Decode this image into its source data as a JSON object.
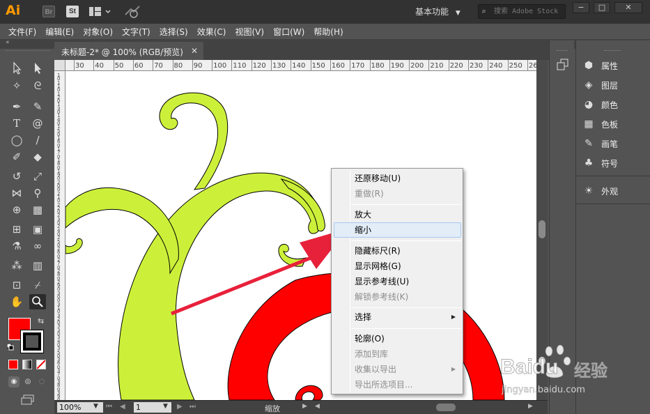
{
  "app": {
    "logo": "Ai",
    "bridge_label": "Br",
    "stock_label": "St",
    "workspace": "基本功能",
    "search_placeholder": "搜索 Adobe Stock"
  },
  "menu": [
    "文件(F)",
    "编辑(E)",
    "对象(O)",
    "文字(T)",
    "选择(S)",
    "效果(C)",
    "视图(V)",
    "窗口(W)",
    "帮助(H)"
  ],
  "document": {
    "tab_title": "未标题-2* @ 100% (RGB/预览)",
    "ruler_h": [
      "30",
      "40",
      "50",
      "60",
      "70",
      "80",
      "90",
      "100",
      "110",
      "120",
      "130",
      "140",
      "150",
      "160",
      "170",
      "180",
      "190",
      "200",
      "210",
      "220",
      "230",
      "240",
      "250",
      "26"
    ],
    "ruler_v": [
      "1",
      "0",
      "1",
      "1",
      "0",
      "1",
      "2",
      "0",
      "1",
      "3",
      "0",
      "1",
      "4",
      "0",
      "1",
      "5",
      "0",
      "1",
      "6",
      "0",
      "1",
      "7",
      "0",
      "1",
      "8",
      "0",
      "1",
      "9",
      "0",
      "2",
      "0",
      "0",
      "2",
      "1",
      "0",
      "2",
      "2",
      "0",
      "2",
      "3",
      "0",
      "2",
      "4",
      "0",
      "2",
      "5",
      "0",
      "2",
      "6",
      "0",
      "2",
      "7",
      "0",
      "2",
      "8",
      "0",
      "2",
      "9",
      "0",
      "3",
      "0",
      "0",
      "3",
      "1",
      "0",
      "3",
      "2",
      "0",
      "3",
      "3",
      "0",
      "3",
      "4",
      "0",
      "3",
      "5",
      "0",
      "3",
      "6",
      "0",
      "3",
      "7",
      "0",
      "3",
      "8",
      "0",
      "3",
      "9",
      "0",
      "4",
      "0",
      "0"
    ]
  },
  "status": {
    "zoom": "100%",
    "page": "1",
    "tool_name": "缩放"
  },
  "colors": {
    "fill": "#ff0000",
    "stroke": "#000000",
    "vine": "#ccf03a",
    "spiral": "#ff0000",
    "arrow": "#e8213a"
  },
  "panels": [
    {
      "icon": "properties-icon",
      "label": "属性"
    },
    {
      "icon": "layers-icon",
      "label": "图层"
    },
    {
      "icon": "color-icon",
      "label": "颜色"
    },
    {
      "icon": "swatches-icon",
      "label": "色板"
    },
    {
      "icon": "brushes-icon",
      "label": "画笔"
    },
    {
      "icon": "symbols-icon",
      "label": "符号"
    },
    {
      "icon": "appearance-icon",
      "label": "外观"
    }
  ],
  "context_menu": {
    "items": [
      {
        "label": "还原移动(U)",
        "enabled": true
      },
      {
        "label": "重做(R)",
        "enabled": false
      },
      {
        "label": "放大",
        "enabled": true
      },
      {
        "label": "缩小",
        "enabled": true,
        "highlighted": true
      },
      {
        "label": "隐藏标尺(R)",
        "enabled": true
      },
      {
        "label": "显示网格(G)",
        "enabled": true
      },
      {
        "label": "显示参考线(U)",
        "enabled": true
      },
      {
        "label": "解锁参考线(K)",
        "enabled": false
      },
      {
        "label": "选择",
        "enabled": true,
        "submenu": true
      },
      {
        "label": "轮廓(O)",
        "enabled": true
      },
      {
        "label": "添加到库",
        "enabled": false
      },
      {
        "label": "收集以导出",
        "enabled": false,
        "submenu": true
      },
      {
        "label": "导出所选项目...",
        "enabled": false
      }
    ]
  },
  "watermark": {
    "brand": "Baidu",
    "brand_cn": "经验",
    "url": "jingyan.baidu.com"
  }
}
